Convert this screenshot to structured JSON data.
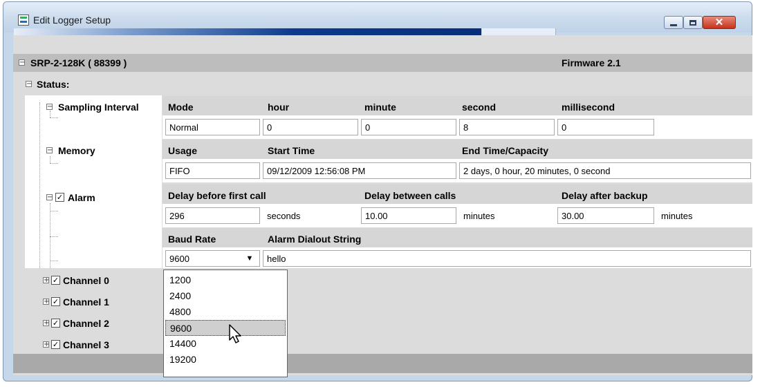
{
  "window": {
    "title": "Edit Logger Setup"
  },
  "device": {
    "name": "SRP-2-128K ( 88399 )",
    "firmware": "Firmware 2.1"
  },
  "status": {
    "label": "Status:"
  },
  "sampling": {
    "label": "Sampling Interval",
    "headers": {
      "mode": "Mode",
      "hour": "hour",
      "minute": "minute",
      "second": "second",
      "millisecond": "millisecond"
    },
    "values": {
      "mode": "Normal",
      "hour": "0",
      "minute": "0",
      "second": "8",
      "millisecond": "0"
    }
  },
  "memory": {
    "label": "Memory",
    "headers": {
      "usage": "Usage",
      "start": "Start Time",
      "end": "End Time/Capacity"
    },
    "values": {
      "usage": "FIFO",
      "start": "09/12/2009 12:56:08 PM",
      "end": "2 days, 0 hour, 20 minutes, 0 second"
    }
  },
  "alarm": {
    "label": "Alarm",
    "checked": true,
    "headers": {
      "delay_first": "Delay before first call",
      "delay_between": "Delay between calls",
      "delay_after": "Delay after backup"
    },
    "values": {
      "delay_first": "296",
      "delay_between": "10.00",
      "delay_after": "30.00"
    },
    "units": {
      "first": "seconds",
      "between": "minutes",
      "after": "minutes"
    },
    "baud_header": "Baud Rate",
    "dialout_header": "Alarm Dialout String",
    "baud_value": "9600",
    "dialout_value": "hello"
  },
  "baud_options": [
    "1200",
    "2400",
    "4800",
    "9600",
    "14400",
    "19200"
  ],
  "baud_selected": "9600",
  "channels": [
    {
      "label": "Channel 0",
      "checked": true
    },
    {
      "label": "Channel 1",
      "checked": true
    },
    {
      "label": "Channel 2",
      "checked": true
    },
    {
      "label": "Channel 3",
      "checked": true
    }
  ],
  "icons": {
    "expand": "plus-box-icon",
    "collapse": "minus-box-icon",
    "check": "checkbox-icon",
    "cursor": "mouse-pointer-icon"
  }
}
